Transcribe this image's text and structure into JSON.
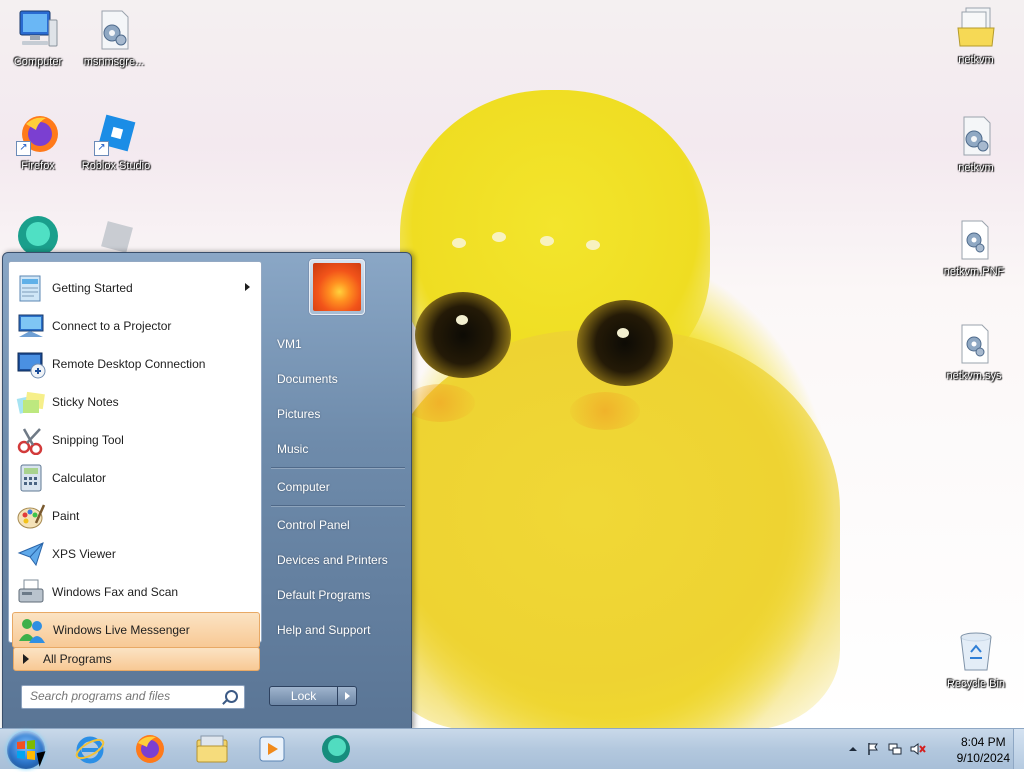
{
  "desktop": {
    "icons": [
      {
        "label": "Computer",
        "icon": "computer-icon"
      },
      {
        "label": "msnmsgre...",
        "icon": "settings-file-icon"
      },
      {
        "label": "Firefox",
        "icon": "firefox-icon"
      },
      {
        "label": "Roblox Studio",
        "icon": "roblox-studio-icon"
      },
      {
        "label": "netkvm",
        "icon": "folder-stack-icon"
      },
      {
        "label": "netkvm",
        "icon": "settings-file-icon"
      },
      {
        "label": "netkvm.PNF",
        "icon": "settings-file-icon"
      },
      {
        "label": "netkvm.sys",
        "icon": "settings-file-icon"
      },
      {
        "label": "Recycle Bin",
        "icon": "recycle-bin-icon"
      }
    ]
  },
  "start_menu": {
    "programs": [
      {
        "label": "Getting Started",
        "icon": "getting-started-icon",
        "has_submenu": true
      },
      {
        "label": "Connect to a Projector",
        "icon": "projector-icon"
      },
      {
        "label": "Remote Desktop Connection",
        "icon": "remote-desktop-icon"
      },
      {
        "label": "Sticky Notes",
        "icon": "sticky-notes-icon"
      },
      {
        "label": "Snipping Tool",
        "icon": "scissors-icon"
      },
      {
        "label": "Calculator",
        "icon": "calculator-icon"
      },
      {
        "label": "Paint",
        "icon": "paint-palette-icon"
      },
      {
        "label": "XPS Viewer",
        "icon": "paper-plane-icon"
      },
      {
        "label": "Windows Fax and Scan",
        "icon": "fax-icon"
      },
      {
        "label": "Windows Live Messenger",
        "icon": "messenger-icon",
        "highlighted": true
      }
    ],
    "all_programs": "All Programs",
    "search_placeholder": "Search programs and files",
    "right_links": [
      {
        "label": "VM1"
      },
      {
        "label": "Documents"
      },
      {
        "label": "Pictures"
      },
      {
        "label": "Music"
      },
      {
        "label": "Computer"
      },
      {
        "label": "Control Panel"
      },
      {
        "label": "Devices and Printers"
      },
      {
        "label": "Default Programs"
      },
      {
        "label": "Help and Support"
      }
    ],
    "lock_label": "Lock"
  },
  "taskbar": {
    "pinned": [
      {
        "icon": "internet-explorer-icon"
      },
      {
        "icon": "firefox-icon"
      },
      {
        "icon": "file-explorer-icon"
      },
      {
        "icon": "media-player-icon"
      },
      {
        "icon": "messenger-app-icon"
      }
    ],
    "clock_time": "8:04 PM",
    "clock_date": "9/10/2024"
  }
}
